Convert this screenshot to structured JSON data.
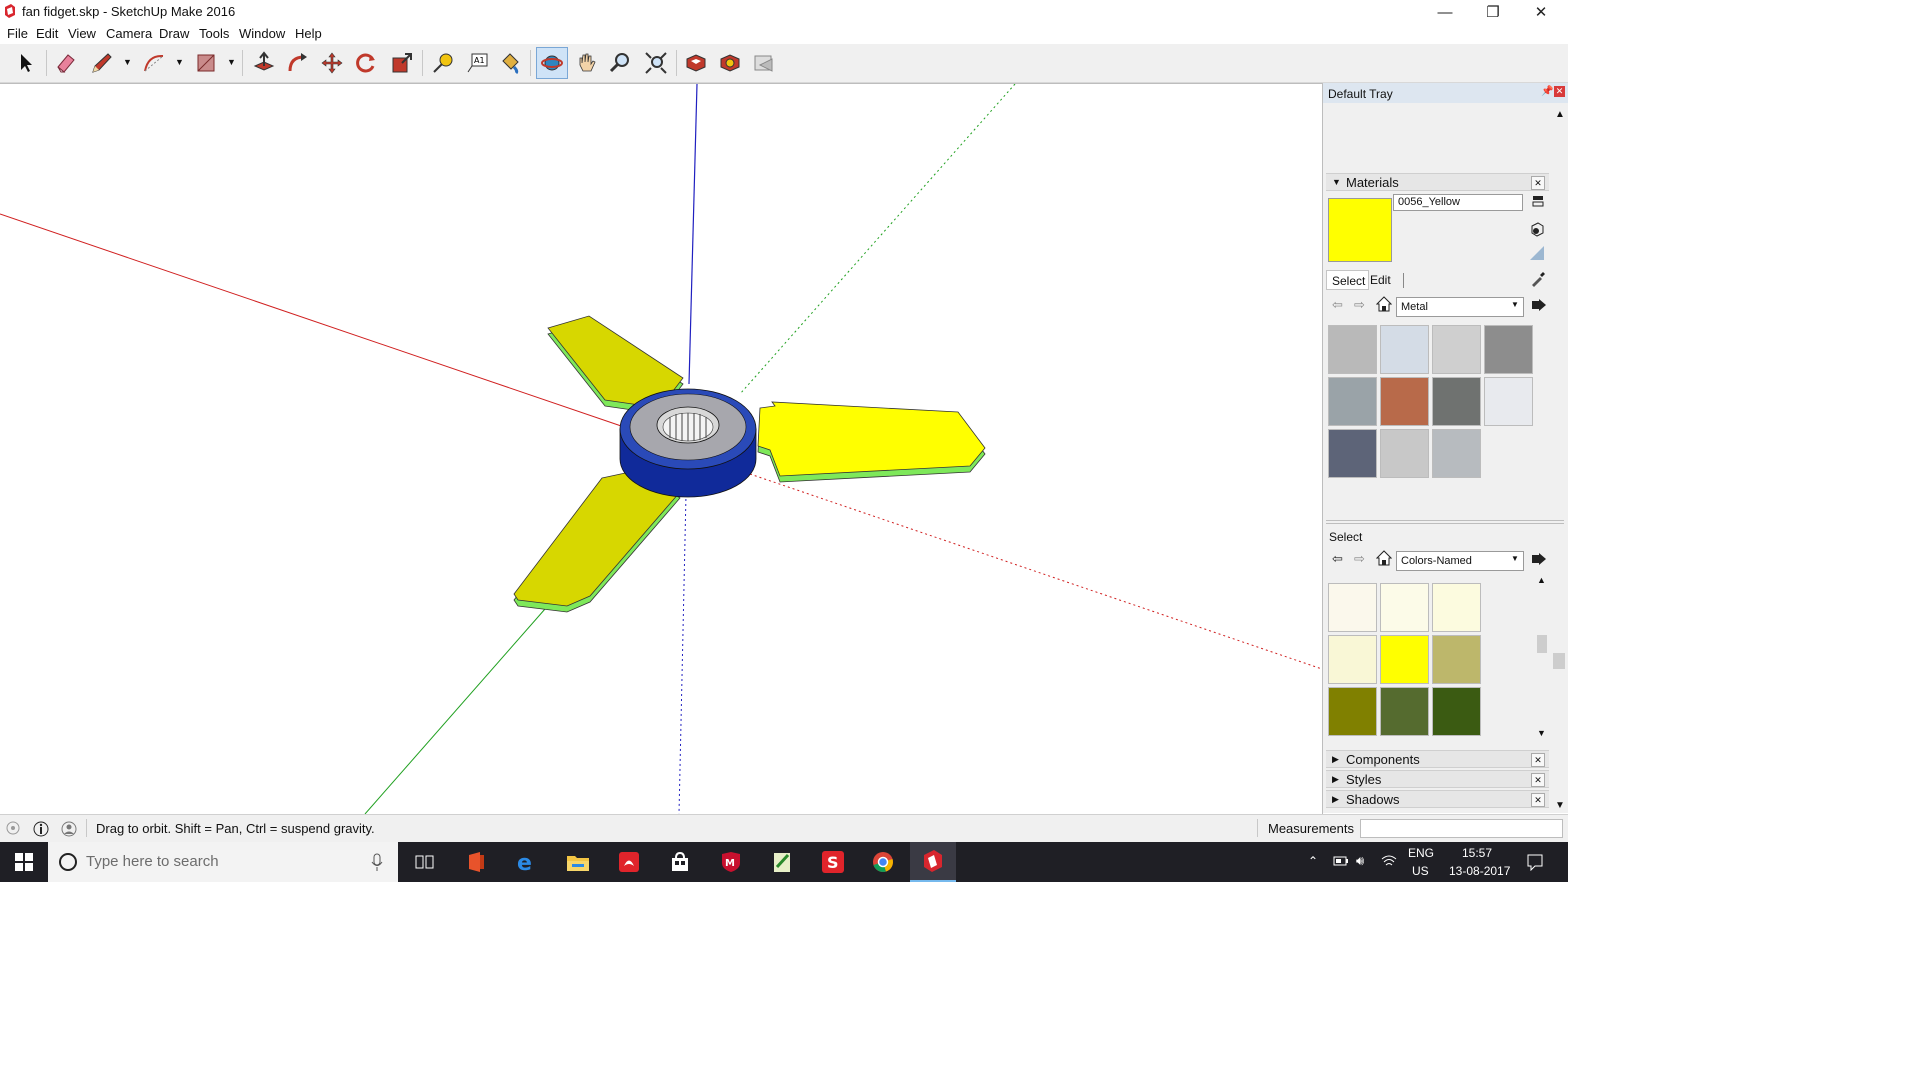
{
  "window": {
    "title": "fan fidget.skp - SketchUp Make 2016",
    "minimize_glyph": "—",
    "restore_glyph": "❐",
    "close_glyph": "✕"
  },
  "menu": [
    "File",
    "Edit",
    "View",
    "Camera",
    "Draw",
    "Tools",
    "Window",
    "Help"
  ],
  "toolbar": {
    "tools": [
      "select-arrow-icon",
      "eraser-icon",
      "pencil-line-icon",
      "arc-icon",
      "rectangle-icon",
      "push-pull-icon",
      "follow-me-icon",
      "move-icon",
      "rotate-icon",
      "scale-icon",
      "tape-measure-icon",
      "text-icon",
      "paint-bucket-icon",
      "orbit-icon",
      "pan-hand-icon",
      "zoom-icon",
      "zoom-extents-icon",
      "3d-warehouse-icon",
      "extension-warehouse-icon",
      "send-to-layout-icon"
    ],
    "active_tool": "orbit-icon"
  },
  "tray": {
    "title": "Default Tray",
    "materials": {
      "header": "Materials",
      "current_material": "0056_Yellow",
      "current_color": "#ffff00",
      "tabs": [
        "Select",
        "Edit"
      ],
      "active_tab": "Select",
      "library": "Metal",
      "metal_swatches": [
        "#b9b9b9",
        "#d4dce6",
        "#cfcfcf",
        "#8d8d8d",
        "#9aa3a8",
        "#b86a4a",
        "#6f7270",
        "#e8eaee",
        "#5d6478",
        "#c8c8c8",
        "#b7bbbf"
      ],
      "secondary_label": "Select",
      "secondary_library": "Colors-Named",
      "color_swatches": [
        "#fbf8ec",
        "#fcfbe8",
        "#fcfbdf",
        "#f9f7d6",
        "#ffff00",
        "#bdb76b",
        "#808000",
        "#556b2f",
        "#3b5b12"
      ]
    },
    "collapsed_panels": [
      "Components",
      "Styles",
      "Shadows"
    ]
  },
  "status": {
    "hint": "Drag to orbit. Shift = Pan, Ctrl = suspend gravity.",
    "measurements_label": "Measurements",
    "measurements_value": ""
  },
  "taskbar": {
    "search_placeholder": "Type here to search",
    "apps": [
      "task-view-icon",
      "office-icon",
      "edge-icon",
      "file-explorer-icon",
      "acrobat-icon",
      "store-icon",
      "mcafee-icon",
      "notepad-icon",
      "sketch-app-icon",
      "chrome-icon",
      "sketchup-icon"
    ],
    "active_app": "sketchup-icon",
    "lang_1": "ENG",
    "lang_2": "US",
    "time": "15:57",
    "date": "13-08-2017"
  }
}
